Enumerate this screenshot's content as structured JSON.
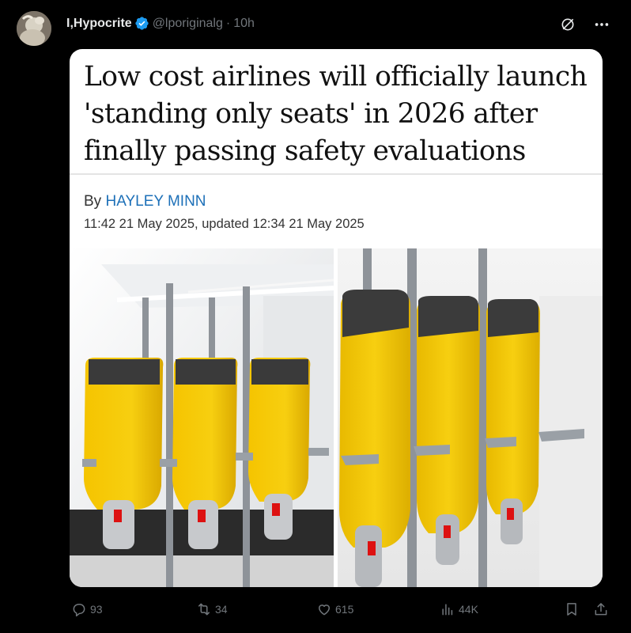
{
  "post": {
    "display_name": "I,Hypocrite",
    "handle": "@lporiginalg",
    "separator": "·",
    "time": "10h"
  },
  "article": {
    "headline": "Low cost airlines will officially launch 'standing only seats' in 2026 after finally passing safety evaluations",
    "byline_prefix": "By",
    "author": "HAYLEY MINN",
    "dateline": "11:42 21 May 2025, updated 12:34 21 May 2025"
  },
  "actions": {
    "replies": "93",
    "reposts": "34",
    "likes": "615",
    "views": "44K"
  },
  "icons": {
    "verified": "verified-badge-icon",
    "grok": "grok-icon",
    "more": "more-icon",
    "reply": "reply-icon",
    "repost": "repost-icon",
    "like": "heart-icon",
    "views": "views-icon",
    "bookmark": "bookmark-icon",
    "share": "share-icon"
  },
  "colors": {
    "background": "#000000",
    "name": "#e7e9ea",
    "muted": "#71767b",
    "verified": "#1d9bf0",
    "author_link": "#1d70b8",
    "seat_yellow": "#f2c400",
    "headrest": "#3a3a3a"
  }
}
